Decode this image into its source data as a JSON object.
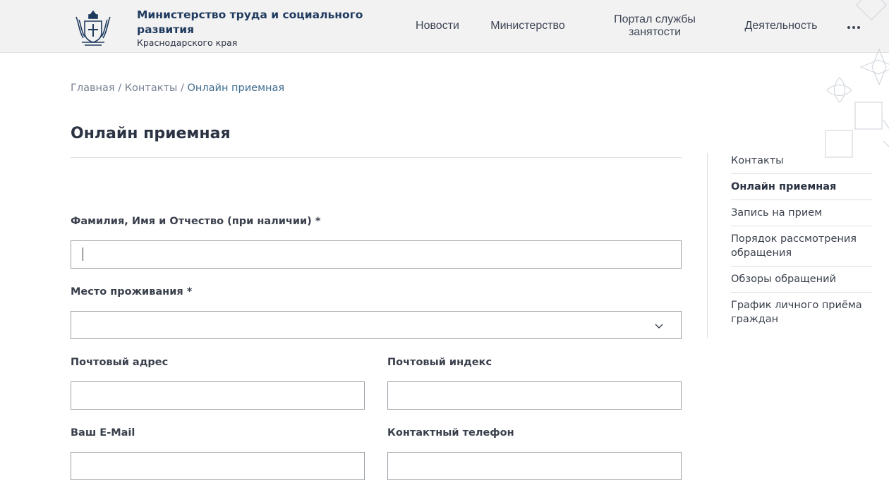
{
  "header": {
    "org_name": "Министерство труда и социального развития",
    "org_sub": "Краснодарского края",
    "nav": [
      {
        "label": "Новости"
      },
      {
        "label": "Министерство"
      },
      {
        "label": "Портал службы занятости"
      },
      {
        "label": "Деятельность"
      }
    ],
    "more_icon": "more-dots-icon"
  },
  "breadcrumb": {
    "items": [
      "Главная",
      "Контакты",
      "Онлайн приемная"
    ],
    "separator": " / "
  },
  "page": {
    "title": "Онлайн приемная"
  },
  "form": {
    "fullname_label": "Фамилия, Имя и Отчество (при наличии) *",
    "fullname_value": "",
    "residence_label": "Место проживания *",
    "residence_value": "",
    "postal_address_label": "Почтовый адрес",
    "postal_address_value": "",
    "postal_code_label": "Почтовый индекс",
    "postal_code_value": "",
    "email_label": "Ваш E-Mail",
    "email_value": "",
    "phone_label": "Контактный телефон",
    "phone_value": ""
  },
  "sidebar": {
    "items": [
      {
        "label": "Контакты",
        "active": false
      },
      {
        "label": "Онлайн приемная",
        "active": true
      },
      {
        "label": "Запись на прием",
        "active": false
      },
      {
        "label": "Порядок рассмотрения обращения",
        "active": false
      },
      {
        "label": "Обзоры обращений",
        "active": false
      },
      {
        "label": "График личного приёма граждан",
        "active": false
      }
    ]
  },
  "colors": {
    "header_bg": "#f2f2f2",
    "org_name": "#1f3a5f",
    "breadcrumb_current": "#3f6c8f",
    "field_border": "#9aa0a8"
  }
}
